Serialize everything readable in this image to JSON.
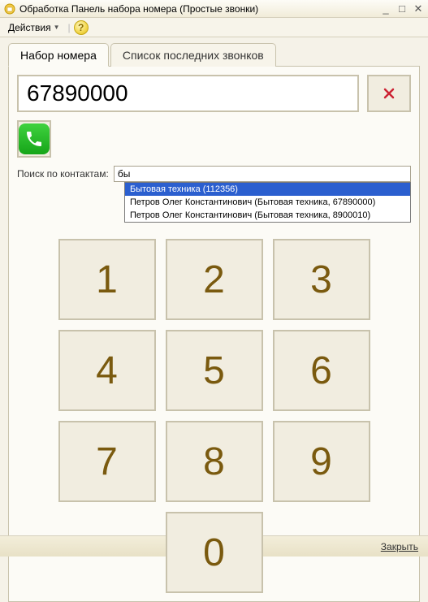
{
  "titlebar": {
    "title": "Обработка  Панель набора номера (Простые звонки)"
  },
  "menubar": {
    "actions": "Действия",
    "help": "?"
  },
  "tabs": {
    "dial": "Набор номера",
    "recent": "Список последних звонков"
  },
  "dial": {
    "number": "67890000"
  },
  "search": {
    "label": "Поиск по контактам:",
    "value": "бы",
    "results": [
      "Бытовая техника (112356)",
      "Петров Олег Константинович (Бытовая техника, 67890000)",
      "Петров Олег Константинович (Бытовая техника, 8900010)"
    ],
    "selectedIndex": 0
  },
  "keypad": {
    "keys": [
      "1",
      "2",
      "3",
      "4",
      "5",
      "6",
      "7",
      "8",
      "9",
      "0"
    ]
  },
  "footer": {
    "close": "Закрыть"
  }
}
